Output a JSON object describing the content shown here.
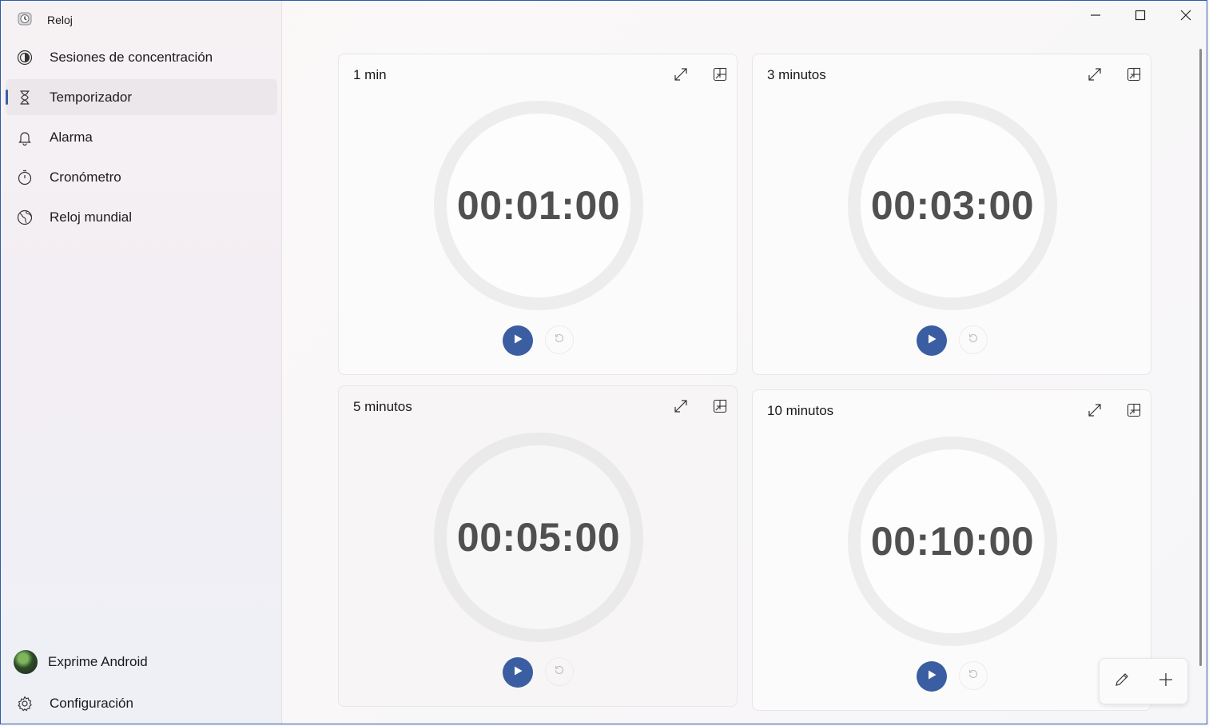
{
  "app": {
    "title": "Reloj",
    "accent_color": "#3a5ea1"
  },
  "sidebar": {
    "items": [
      {
        "label": "Sesiones de concentración",
        "icon": "focus-icon",
        "active": false
      },
      {
        "label": "Temporizador",
        "icon": "hourglass-icon",
        "active": true
      },
      {
        "label": "Alarma",
        "icon": "bell-icon",
        "active": false
      },
      {
        "label": "Cronómetro",
        "icon": "stopwatch-icon",
        "active": false
      },
      {
        "label": "Reloj mundial",
        "icon": "globe-icon",
        "active": false
      }
    ],
    "account": {
      "name": "Exprime Android"
    },
    "settings": {
      "label": "Configuración"
    }
  },
  "timers": [
    {
      "title": "1 min",
      "time": "00:01:00"
    },
    {
      "title": "3 minutos",
      "time": "00:03:00"
    },
    {
      "title": "5 minutos",
      "time": "00:05:00"
    },
    {
      "title": "10 minutos",
      "time": "00:10:00"
    }
  ]
}
